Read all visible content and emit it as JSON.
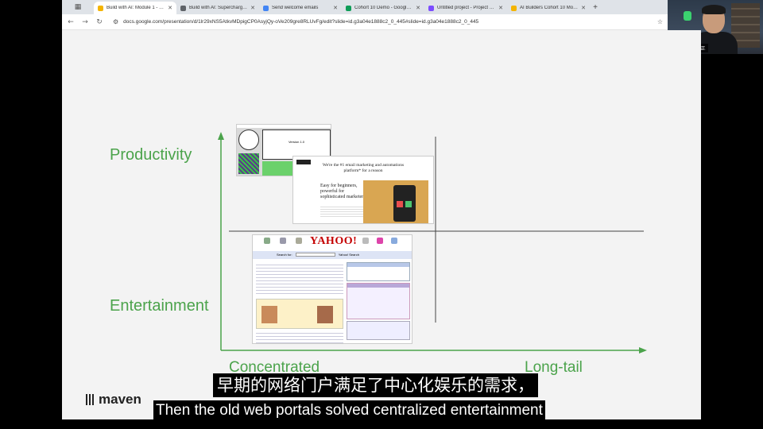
{
  "browser": {
    "tab_switcher_icon": "grid-icon",
    "tabs": [
      {
        "title": "Build with AI: Module 1 - Goo",
        "favicon_color": "#f4b400",
        "active": true
      },
      {
        "title": "Build with AI: Supercharge Cl",
        "favicon_color": "#5f6368",
        "active": false
      },
      {
        "title": "Send welcome emails",
        "favicon_color": "#4285f4",
        "active": false
      },
      {
        "title": "Cohort 10 Demo - Google She",
        "favicon_color": "#0f9d58",
        "active": false
      },
      {
        "title": "Untitled project - Project Edi",
        "favicon_color": "#7c4dff",
        "active": false
      },
      {
        "title": "AI Builders Cohort 10 Module",
        "favicon_color": "#f4b400",
        "active": false
      }
    ],
    "url": "docs.google.com/presentation/d/1lr29xNS5AtkvMDpigCP0AsyjQy-oVe209gre8RLUvFg/edit?slide=id.g3a04e1888c2_0_445#slide=id.g3a04e1888c2_0_445"
  },
  "webcam": {
    "label": "YZ | 读代表立正"
  },
  "slide": {
    "y_labels": {
      "top": "Productivity",
      "bottom": "Entertainment"
    },
    "x_labels": {
      "left": "Concentrated",
      "right": "Long-tail"
    },
    "axis_color": "#4ba34b",
    "label_color": "#4ba34b",
    "screenshots": {
      "mac": {
        "caption": "Version 1.0"
      },
      "mailchimp": {
        "headline": "We're the #1 email marketing and automations platform* for a reason",
        "sub": "Easy for beginners, powerful for sophisticated marketers"
      },
      "yahoo": {
        "logo": "YAHOO!",
        "search_label": "Search for:",
        "search_button": "Yahoo! Search"
      }
    },
    "brand": "maven"
  },
  "captions": {
    "chinese": "早期的网络门户满足了中心化娱乐的需求，",
    "english": "Then the old web portals solved centralized entertainment"
  }
}
